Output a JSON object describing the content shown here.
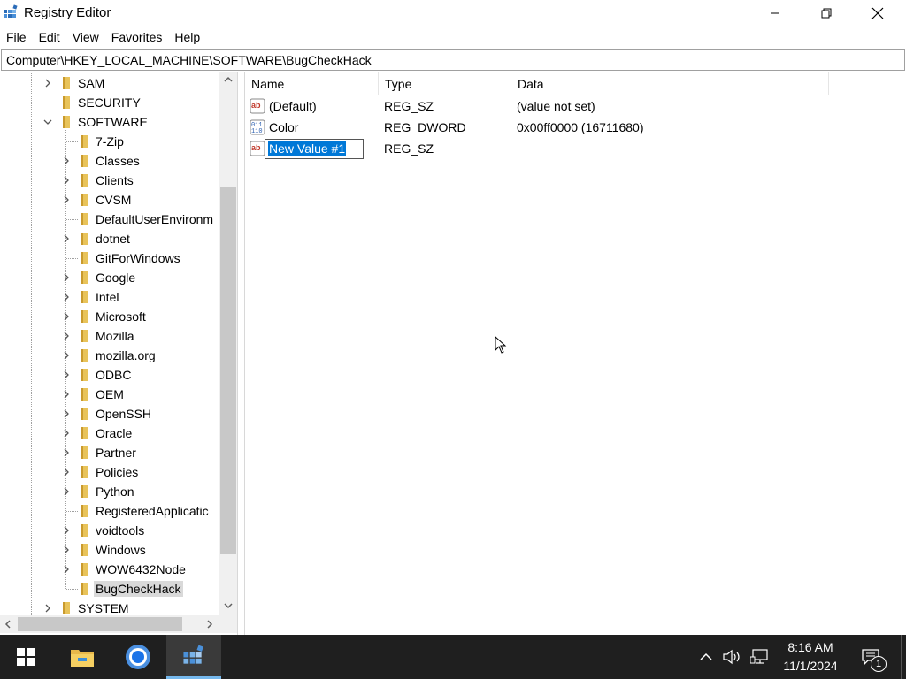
{
  "window": {
    "title": "Registry Editor"
  },
  "menu": [
    "File",
    "Edit",
    "View",
    "Favorites",
    "Help"
  ],
  "address": "Computer\\HKEY_LOCAL_MACHINE\\SOFTWARE\\BugCheckHack",
  "tree": {
    "items": [
      {
        "label": "SAM",
        "level": 1,
        "expander": "collapsed",
        "selected": false
      },
      {
        "label": "SECURITY",
        "level": 1,
        "expander": "none",
        "selected": false
      },
      {
        "label": "SOFTWARE",
        "level": 1,
        "expander": "expanded",
        "selected": false
      },
      {
        "label": "7-Zip",
        "level": 2,
        "expander": "none",
        "selected": false
      },
      {
        "label": "Classes",
        "level": 2,
        "expander": "collapsed",
        "selected": false
      },
      {
        "label": "Clients",
        "level": 2,
        "expander": "collapsed",
        "selected": false
      },
      {
        "label": "CVSM",
        "level": 2,
        "expander": "collapsed",
        "selected": false
      },
      {
        "label": "DefaultUserEnvironm",
        "level": 2,
        "expander": "none",
        "selected": false
      },
      {
        "label": "dotnet",
        "level": 2,
        "expander": "collapsed",
        "selected": false
      },
      {
        "label": "GitForWindows",
        "level": 2,
        "expander": "none",
        "selected": false
      },
      {
        "label": "Google",
        "level": 2,
        "expander": "collapsed",
        "selected": false
      },
      {
        "label": "Intel",
        "level": 2,
        "expander": "collapsed",
        "selected": false
      },
      {
        "label": "Microsoft",
        "level": 2,
        "expander": "collapsed",
        "selected": false
      },
      {
        "label": "Mozilla",
        "level": 2,
        "expander": "collapsed",
        "selected": false
      },
      {
        "label": "mozilla.org",
        "level": 2,
        "expander": "collapsed",
        "selected": false
      },
      {
        "label": "ODBC",
        "level": 2,
        "expander": "collapsed",
        "selected": false
      },
      {
        "label": "OEM",
        "level": 2,
        "expander": "collapsed",
        "selected": false
      },
      {
        "label": "OpenSSH",
        "level": 2,
        "expander": "collapsed",
        "selected": false
      },
      {
        "label": "Oracle",
        "level": 2,
        "expander": "collapsed",
        "selected": false
      },
      {
        "label": "Partner",
        "level": 2,
        "expander": "collapsed",
        "selected": false
      },
      {
        "label": "Policies",
        "level": 2,
        "expander": "collapsed",
        "selected": false
      },
      {
        "label": "Python",
        "level": 2,
        "expander": "collapsed",
        "selected": false
      },
      {
        "label": "RegisteredApplicatic",
        "level": 2,
        "expander": "none",
        "selected": false
      },
      {
        "label": "voidtools",
        "level": 2,
        "expander": "collapsed",
        "selected": false
      },
      {
        "label": "Windows",
        "level": 2,
        "expander": "collapsed",
        "selected": false
      },
      {
        "label": "WOW6432Node",
        "level": 2,
        "expander": "collapsed",
        "selected": false
      },
      {
        "label": "BugCheckHack",
        "level": 2,
        "expander": "none",
        "selected": true
      },
      {
        "label": "SYSTEM",
        "level": 1,
        "expander": "collapsed",
        "selected": false
      }
    ]
  },
  "list": {
    "columns": {
      "name": "Name",
      "type": "Type",
      "data": "Data"
    },
    "rows": [
      {
        "name": "(Default)",
        "type": "REG_SZ",
        "data": "(value not set)",
        "icon": "string-value-icon"
      },
      {
        "name": "Color",
        "type": "REG_DWORD",
        "data": "0x00ff0000 (16711680)",
        "icon": "binary-value-icon"
      },
      {
        "name": "",
        "type": "REG_SZ",
        "data": "",
        "icon": "string-value-icon"
      }
    ],
    "rename_value": "New Value #1"
  },
  "taskbar": {
    "time": "8:16 AM",
    "date": "11/1/2024",
    "notification_count": "1"
  },
  "colors": {
    "selection": "#0078d7",
    "taskbar": "#1f1f1f",
    "folder": "#e8c35a"
  }
}
